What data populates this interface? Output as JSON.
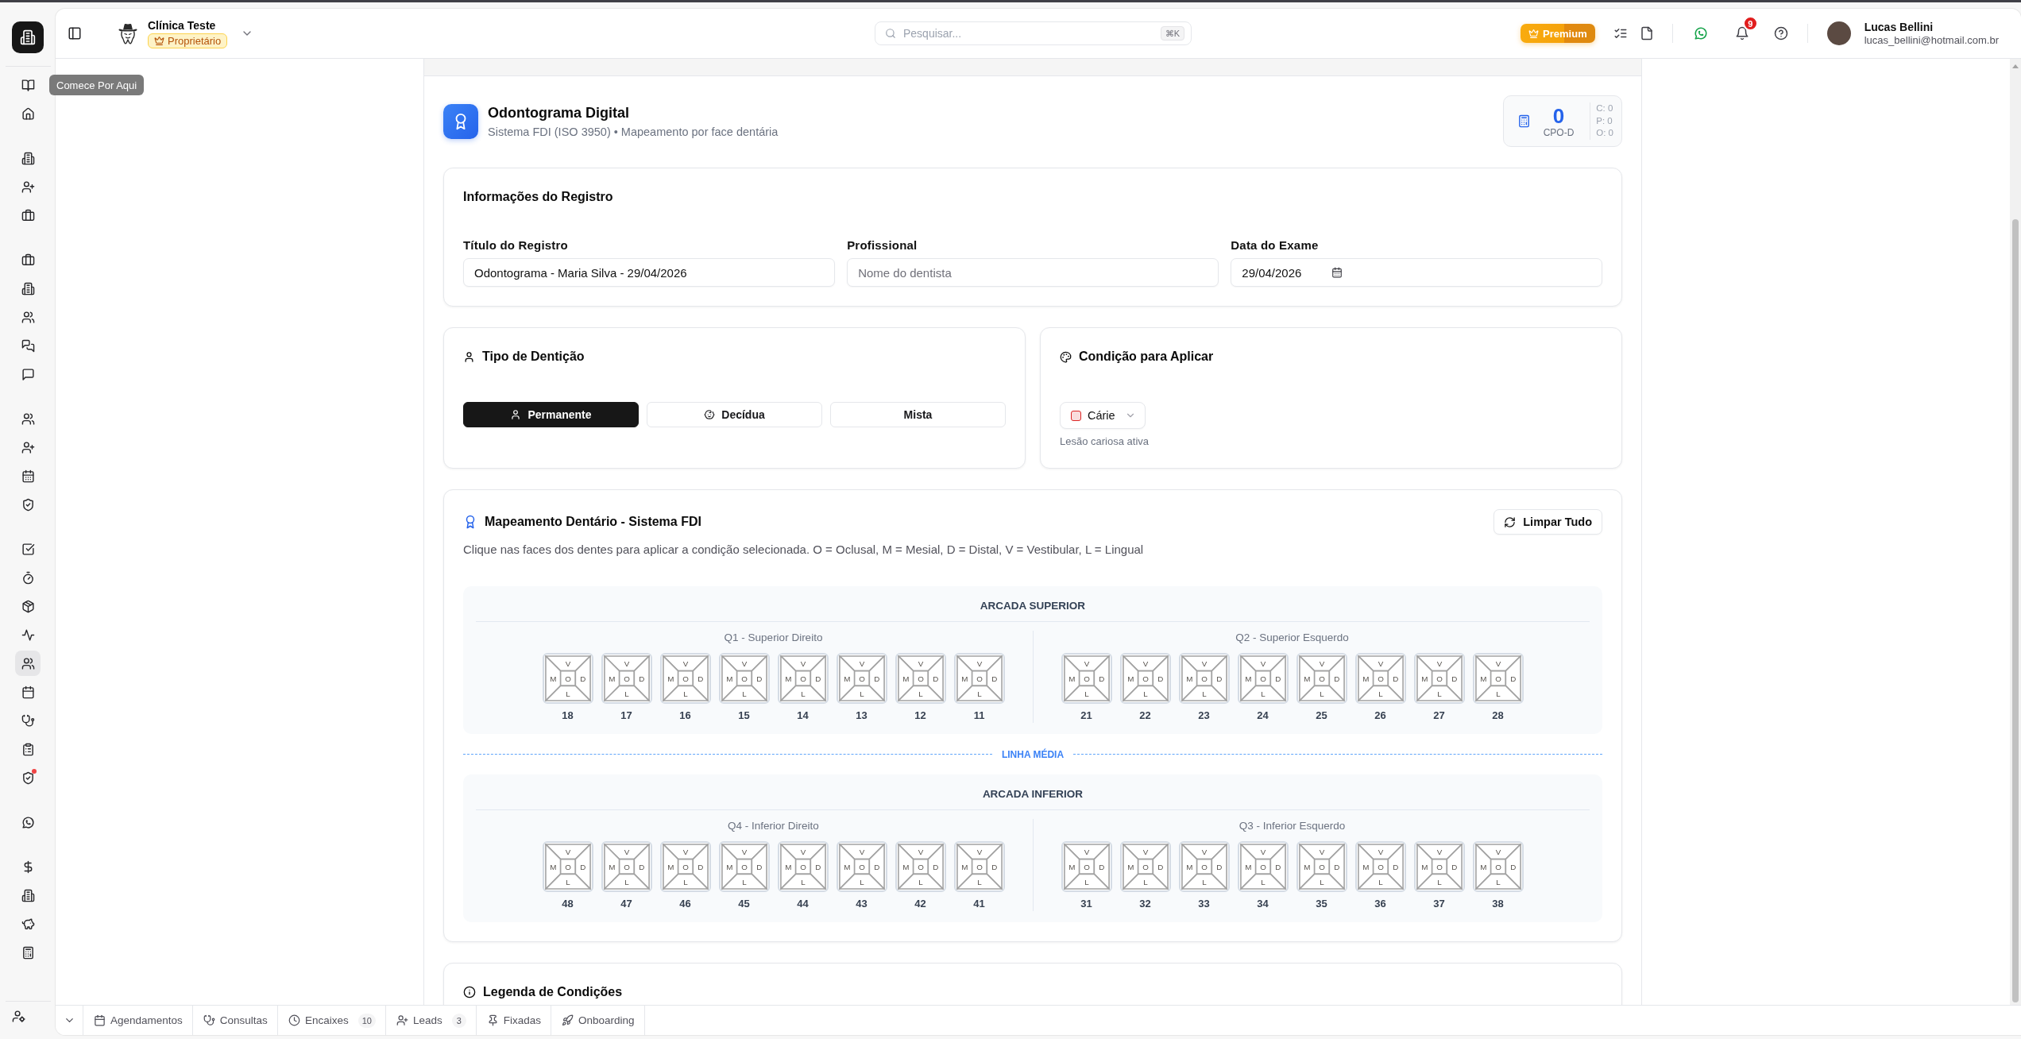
{
  "rail": {
    "groups": [
      {
        "items": [
          {
            "selected": false,
            "alert": false
          },
          {
            "selected": false,
            "alert": false
          }
        ]
      },
      {
        "items": [
          {
            "selected": false,
            "alert": false
          },
          {
            "selected": false,
            "alert": false
          },
          {
            "selected": false,
            "alert": false
          }
        ]
      },
      {
        "items": [
          {
            "selected": false,
            "alert": false
          },
          {
            "selected": false,
            "alert": false
          },
          {
            "selected": false,
            "alert": false
          },
          {
            "selected": false,
            "alert": false
          },
          {
            "selected": false,
            "alert": false
          }
        ]
      },
      {
        "items": [
          {
            "selected": false,
            "alert": false
          },
          {
            "selected": false,
            "alert": false
          },
          {
            "selected": false,
            "alert": false
          },
          {
            "selected": false,
            "alert": false
          }
        ]
      },
      {
        "items": [
          {
            "selected": false,
            "alert": false
          },
          {
            "selected": false,
            "alert": false
          },
          {
            "selected": false,
            "alert": false
          },
          {
            "selected": false,
            "alert": false
          },
          {
            "selected": true,
            "alert": false
          },
          {
            "selected": false,
            "alert": false
          },
          {
            "selected": false,
            "alert": false
          },
          {
            "selected": false,
            "alert": false
          },
          {
            "selected": false,
            "alert": true
          }
        ]
      },
      {
        "items": [
          {
            "selected": false,
            "alert": false
          }
        ]
      },
      {
        "items": [
          {
            "selected": false,
            "alert": false
          },
          {
            "selected": false,
            "alert": false
          },
          {
            "selected": false,
            "alert": false
          },
          {
            "selected": false,
            "alert": false
          }
        ]
      }
    ],
    "tooltip": "Comece Por Aqui"
  },
  "header": {
    "clinic": {
      "name": "Clínica Teste",
      "role": "Proprietário"
    },
    "search": {
      "placeholder": "Pesquisar...",
      "shortcut": "⌘K"
    },
    "premium_button": "Premium",
    "notifications": {
      "count": "9"
    },
    "user": {
      "name": "Lucas Bellini",
      "email": "lucas_bellini@hotmail.com.br"
    }
  },
  "page": {
    "title": "Odontograma Digital",
    "subtitle": "Sistema FDI (ISO 3950) • Mapeamento por face dentária",
    "cpo": {
      "value": "0",
      "label": "CPO-D",
      "breakdown": [
        "C: 0",
        "P: 0",
        "O: 0"
      ]
    }
  },
  "record": {
    "title": "Informações do Registro",
    "fields": [
      {
        "kind": "text",
        "label": "Título do Registro",
        "value": "Odontograma - Maria Silva - 29/04/2026"
      },
      {
        "kind": "text",
        "label": "Profissional",
        "placeholder": "Nome do dentista"
      },
      {
        "kind": "date",
        "label": "Data do Exame",
        "value": "29/04/2026"
      }
    ]
  },
  "dentition": {
    "title": "Tipo de Dentição",
    "options": [
      {
        "label": "Permanente",
        "selected": true
      },
      {
        "label": "Decídua",
        "selected": false
      },
      {
        "label": "Mista",
        "selected": false
      }
    ]
  },
  "condition": {
    "title": "Condição para Aplicar",
    "dropdown": {
      "label": "Cárie",
      "color": "#dc2626"
    },
    "description": "Lesão cariosa ativa"
  },
  "mapping": {
    "title": "Mapeamento Dentário - Sistema FDI",
    "clear_button": "Limpar Tudo",
    "instructions": "Clique nas faces dos dentes para aplicar a condição selecionada. O = Oclusal, M = Mesial, D = Distal, V = Vestibular, L = Lingual",
    "midline": "LINHA MÉDIA",
    "arches": [
      {
        "title": "ARCADA SUPERIOR",
        "quadrants": [
          {
            "label": "Q1 - Superior Direito",
            "teeth": [
              {
                "number": "18",
                "faces": [
                  "V",
                  "M",
                  "O",
                  "D",
                  "L"
                ]
              },
              {
                "number": "17",
                "faces": [
                  "V",
                  "M",
                  "O",
                  "D",
                  "L"
                ]
              },
              {
                "number": "16",
                "faces": [
                  "V",
                  "M",
                  "O",
                  "D",
                  "L"
                ]
              },
              {
                "number": "15",
                "faces": [
                  "V",
                  "M",
                  "O",
                  "D",
                  "L"
                ]
              },
              {
                "number": "14",
                "faces": [
                  "V",
                  "M",
                  "O",
                  "D",
                  "L"
                ]
              },
              {
                "number": "13",
                "faces": [
                  "V",
                  "M",
                  "O",
                  "D",
                  "L"
                ]
              },
              {
                "number": "12",
                "faces": [
                  "V",
                  "M",
                  "O",
                  "D",
                  "L"
                ]
              },
              {
                "number": "11",
                "faces": [
                  "V",
                  "M",
                  "O",
                  "D",
                  "L"
                ]
              }
            ]
          },
          {
            "label": "Q2 - Superior Esquerdo",
            "teeth": [
              {
                "number": "21",
                "faces": [
                  "V",
                  "M",
                  "O",
                  "D",
                  "L"
                ]
              },
              {
                "number": "22",
                "faces": [
                  "V",
                  "M",
                  "O",
                  "D",
                  "L"
                ]
              },
              {
                "number": "23",
                "faces": [
                  "V",
                  "M",
                  "O",
                  "D",
                  "L"
                ]
              },
              {
                "number": "24",
                "faces": [
                  "V",
                  "M",
                  "O",
                  "D",
                  "L"
                ]
              },
              {
                "number": "25",
                "faces": [
                  "V",
                  "M",
                  "O",
                  "D",
                  "L"
                ]
              },
              {
                "number": "26",
                "faces": [
                  "V",
                  "M",
                  "O",
                  "D",
                  "L"
                ]
              },
              {
                "number": "27",
                "faces": [
                  "V",
                  "M",
                  "O",
                  "D",
                  "L"
                ]
              },
              {
                "number": "28",
                "faces": [
                  "V",
                  "M",
                  "O",
                  "D",
                  "L"
                ]
              }
            ]
          }
        ]
      },
      {
        "title": "ARCADA INFERIOR",
        "quadrants": [
          {
            "label": "Q4 - Inferior Direito",
            "teeth": [
              {
                "number": "48",
                "faces": [
                  "V",
                  "M",
                  "O",
                  "D",
                  "L"
                ]
              },
              {
                "number": "47",
                "faces": [
                  "V",
                  "M",
                  "O",
                  "D",
                  "L"
                ]
              },
              {
                "number": "46",
                "faces": [
                  "V",
                  "M",
                  "O",
                  "D",
                  "L"
                ]
              },
              {
                "number": "45",
                "faces": [
                  "V",
                  "M",
                  "O",
                  "D",
                  "L"
                ]
              },
              {
                "number": "44",
                "faces": [
                  "V",
                  "M",
                  "O",
                  "D",
                  "L"
                ]
              },
              {
                "number": "43",
                "faces": [
                  "V",
                  "M",
                  "O",
                  "D",
                  "L"
                ]
              },
              {
                "number": "42",
                "faces": [
                  "V",
                  "M",
                  "O",
                  "D",
                  "L"
                ]
              },
              {
                "number": "41",
                "faces": [
                  "V",
                  "M",
                  "O",
                  "D",
                  "L"
                ]
              }
            ]
          },
          {
            "label": "Q3 - Inferior Esquerdo",
            "teeth": [
              {
                "number": "31",
                "faces": [
                  "V",
                  "M",
                  "O",
                  "D",
                  "L"
                ]
              },
              {
                "number": "32",
                "faces": [
                  "V",
                  "M",
                  "O",
                  "D",
                  "L"
                ]
              },
              {
                "number": "33",
                "faces": [
                  "V",
                  "M",
                  "O",
                  "D",
                  "L"
                ]
              },
              {
                "number": "34",
                "faces": [
                  "V",
                  "M",
                  "O",
                  "D",
                  "L"
                ]
              },
              {
                "number": "35",
                "faces": [
                  "V",
                  "M",
                  "O",
                  "D",
                  "L"
                ]
              },
              {
                "number": "36",
                "faces": [
                  "V",
                  "M",
                  "O",
                  "D",
                  "L"
                ]
              },
              {
                "number": "37",
                "faces": [
                  "V",
                  "M",
                  "O",
                  "D",
                  "L"
                ]
              },
              {
                "number": "38",
                "faces": [
                  "V",
                  "M",
                  "O",
                  "D",
                  "L"
                ]
              }
            ]
          }
        ]
      }
    ]
  },
  "legend": {
    "title": "Legenda de Condições"
  },
  "bottom_bar": {
    "items": [
      {
        "label": "Agendamentos"
      },
      {
        "label": "Consultas"
      },
      {
        "label": "Encaixes",
        "count": "10"
      },
      {
        "label": "Leads",
        "count": "3"
      },
      {
        "label": "Fixadas"
      },
      {
        "label": "Onboarding"
      }
    ]
  }
}
